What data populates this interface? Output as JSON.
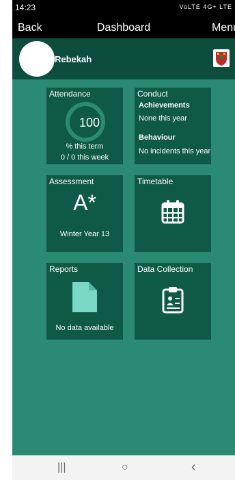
{
  "status": {
    "time": "14:23",
    "icons": "VoLTE 4G+ LTE"
  },
  "nav": {
    "back": "Back",
    "title": "Dashboard",
    "menu": "Menu"
  },
  "user": {
    "name": "Rebekah"
  },
  "tiles": {
    "attendance": {
      "title": "Attendance",
      "value": "100",
      "term": "% this term",
      "week": "0 / 0 this week"
    },
    "conduct": {
      "title": "Conduct",
      "achievements_label": "Achievements",
      "achievements_value": "None this year",
      "behaviour_label": "Behaviour",
      "behaviour_value": "No incidents this year"
    },
    "assessment": {
      "title": "Assessment",
      "grade": "A*",
      "subtitle": "Winter Year 13"
    },
    "timetable": {
      "title": "Timetable"
    },
    "reports": {
      "title": "Reports",
      "status": "No data available"
    },
    "data_collection": {
      "title": "Data Collection"
    }
  },
  "system_nav": {
    "recents": "|||",
    "home": "○",
    "back": "‹"
  },
  "colors": {
    "background": "#2a8a72",
    "tile": "#0f5947",
    "userbar": "#0c4d3d",
    "doc_icon": "#7ad7c3"
  }
}
